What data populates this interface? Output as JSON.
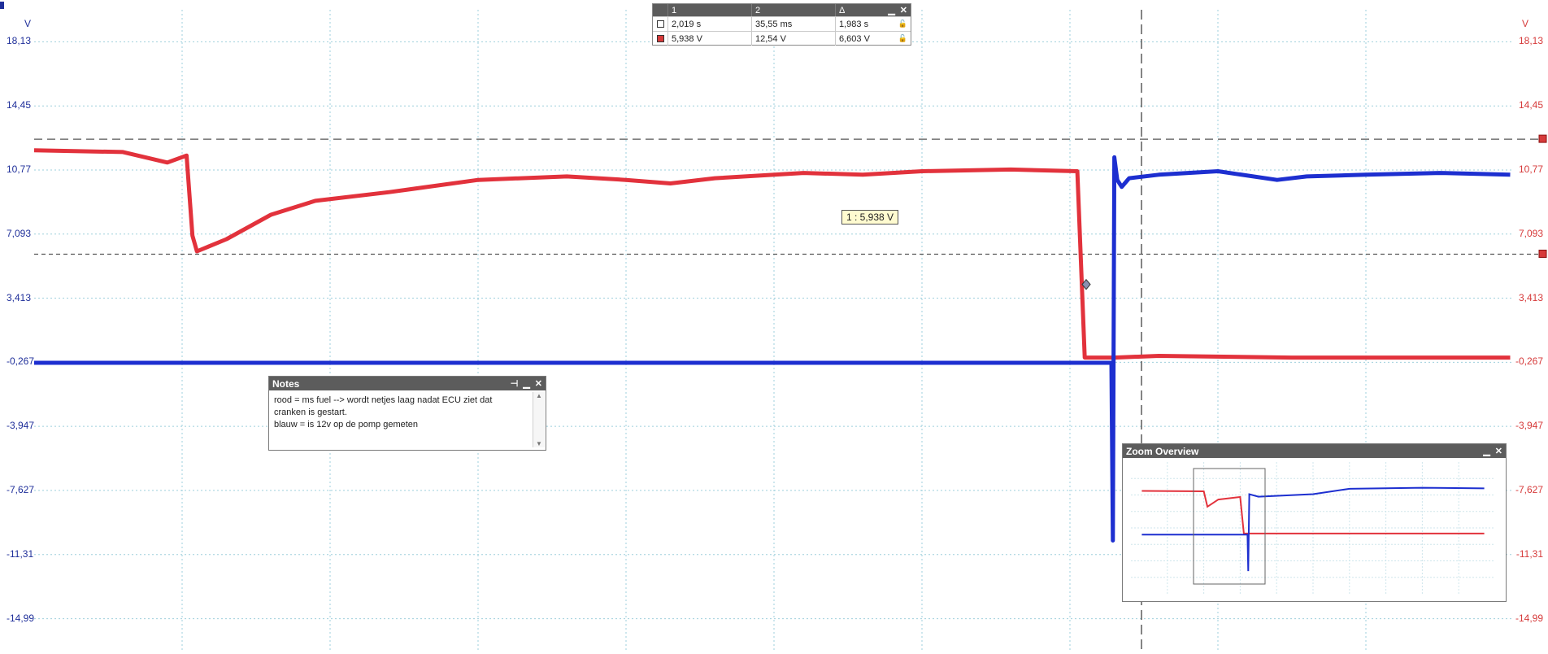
{
  "axes": {
    "left_ticks": [
      "18,13",
      "14,45",
      "10,77",
      "7,093",
      "3,413",
      "-0,267",
      "-3,947",
      "-7,627",
      "-11,31",
      "-14,99"
    ],
    "right_ticks": [
      "18,13",
      "14,45",
      "10,77",
      "7,093",
      "3,413",
      "-0,267",
      "-3,947",
      "-7,627",
      "-11,31",
      "-14,99"
    ],
    "left_unit": "V",
    "right_unit": "V",
    "left_color": "#1f2f9a",
    "right_color": "#d63a3a"
  },
  "measurements": {
    "headers": [
      "1",
      "2",
      "Δ"
    ],
    "rows": [
      {
        "v1": "2,019 s",
        "v2": "35,55 ms",
        "delta": "1,983 s",
        "color": "#ffffff"
      },
      {
        "v1": "5,938 V",
        "v2": "12,54 V",
        "delta": "6,603 V",
        "color": "#d63a3a"
      }
    ]
  },
  "ruler_tooltip": "1 : 5,938 V",
  "notes": {
    "title": "Notes",
    "lines": [
      "rood = ms fuel --> wordt netjes laag nadat ECU ziet dat",
      "cranken is gestart.",
      "blauw = is 12v op de pomp gemeten"
    ]
  },
  "zoom_overview": {
    "title": "Zoom Overview"
  },
  "chart_data": {
    "type": "line",
    "ylim": [
      -16.83,
      19.97
    ],
    "y_ticks": [
      18.13,
      14.45,
      10.77,
      7.093,
      3.413,
      -0.267,
      -3.947,
      -7.627,
      -11.31,
      -14.99
    ],
    "series": [
      {
        "color": "#e2323c",
        "points": [
          [
            0.0,
            11.9
          ],
          [
            0.06,
            11.8
          ],
          [
            0.09,
            11.2
          ],
          [
            0.103,
            11.6
          ],
          [
            0.107,
            7.0
          ],
          [
            0.11,
            6.1
          ],
          [
            0.13,
            6.8
          ],
          [
            0.16,
            8.2
          ],
          [
            0.19,
            9.0
          ],
          [
            0.24,
            9.5
          ],
          [
            0.3,
            10.2
          ],
          [
            0.36,
            10.4
          ],
          [
            0.4,
            10.2
          ],
          [
            0.43,
            10.0
          ],
          [
            0.46,
            10.3
          ],
          [
            0.52,
            10.6
          ],
          [
            0.56,
            10.5
          ],
          [
            0.6,
            10.7
          ],
          [
            0.66,
            10.8
          ],
          [
            0.705,
            10.7
          ],
          [
            0.71,
            0.0
          ],
          [
            0.73,
            0.0
          ],
          [
            0.76,
            0.1
          ],
          [
            0.85,
            0.0
          ],
          [
            0.95,
            0.0
          ],
          [
            0.9975,
            0.0
          ]
        ]
      },
      {
        "color": "#1d2fd0",
        "points": [
          [
            0.0,
            -0.3
          ],
          [
            0.2,
            -0.3
          ],
          [
            0.4,
            -0.3
          ],
          [
            0.6,
            -0.3
          ],
          [
            0.728,
            -0.3
          ],
          [
            0.729,
            -10.5
          ],
          [
            0.73,
            11.5
          ],
          [
            0.732,
            10.2
          ],
          [
            0.735,
            9.8
          ],
          [
            0.74,
            10.3
          ],
          [
            0.76,
            10.5
          ],
          [
            0.8,
            10.7
          ],
          [
            0.84,
            10.2
          ],
          [
            0.86,
            10.4
          ],
          [
            0.9,
            10.5
          ],
          [
            0.95,
            10.6
          ],
          [
            0.9975,
            10.5
          ]
        ]
      }
    ],
    "ruler_levels": [
      12.54,
      5.938
    ]
  }
}
